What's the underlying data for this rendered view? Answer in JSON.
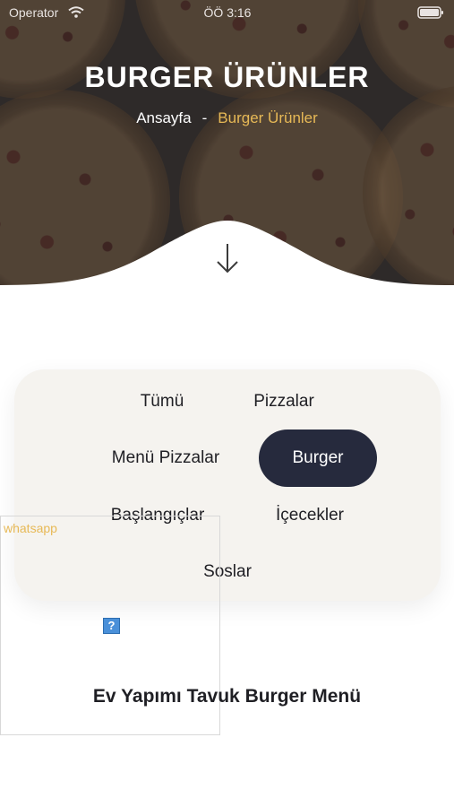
{
  "status_bar": {
    "carrier": "Operator",
    "time": "ÖÖ 3:16"
  },
  "hero": {
    "title": "BURGER ÜRÜNLER",
    "breadcrumb": {
      "home": "Ansayfa",
      "separator": "-",
      "current": "Burger Ürünler"
    },
    "scroll_icon": "arrow-down-icon"
  },
  "categories": {
    "items": [
      {
        "label": "Tümü",
        "active": false
      },
      {
        "label": "Pizzalar",
        "active": false
      },
      {
        "label": "Menü Pizzalar",
        "active": false
      },
      {
        "label": "Burger",
        "active": true
      },
      {
        "label": "Başlangıçlar",
        "active": false
      },
      {
        "label": "İçecekler",
        "active": false
      },
      {
        "label": "Soslar",
        "active": false
      }
    ]
  },
  "whatsapp": {
    "label": "whatsapp",
    "broken_icon_glyph": "?"
  },
  "product": {
    "title": "Ev Yapımı Tavuk Burger Menü"
  },
  "colors": {
    "accent": "#e7b956",
    "active_pill": "#262a3d",
    "card_bg": "#f5f3ef"
  }
}
